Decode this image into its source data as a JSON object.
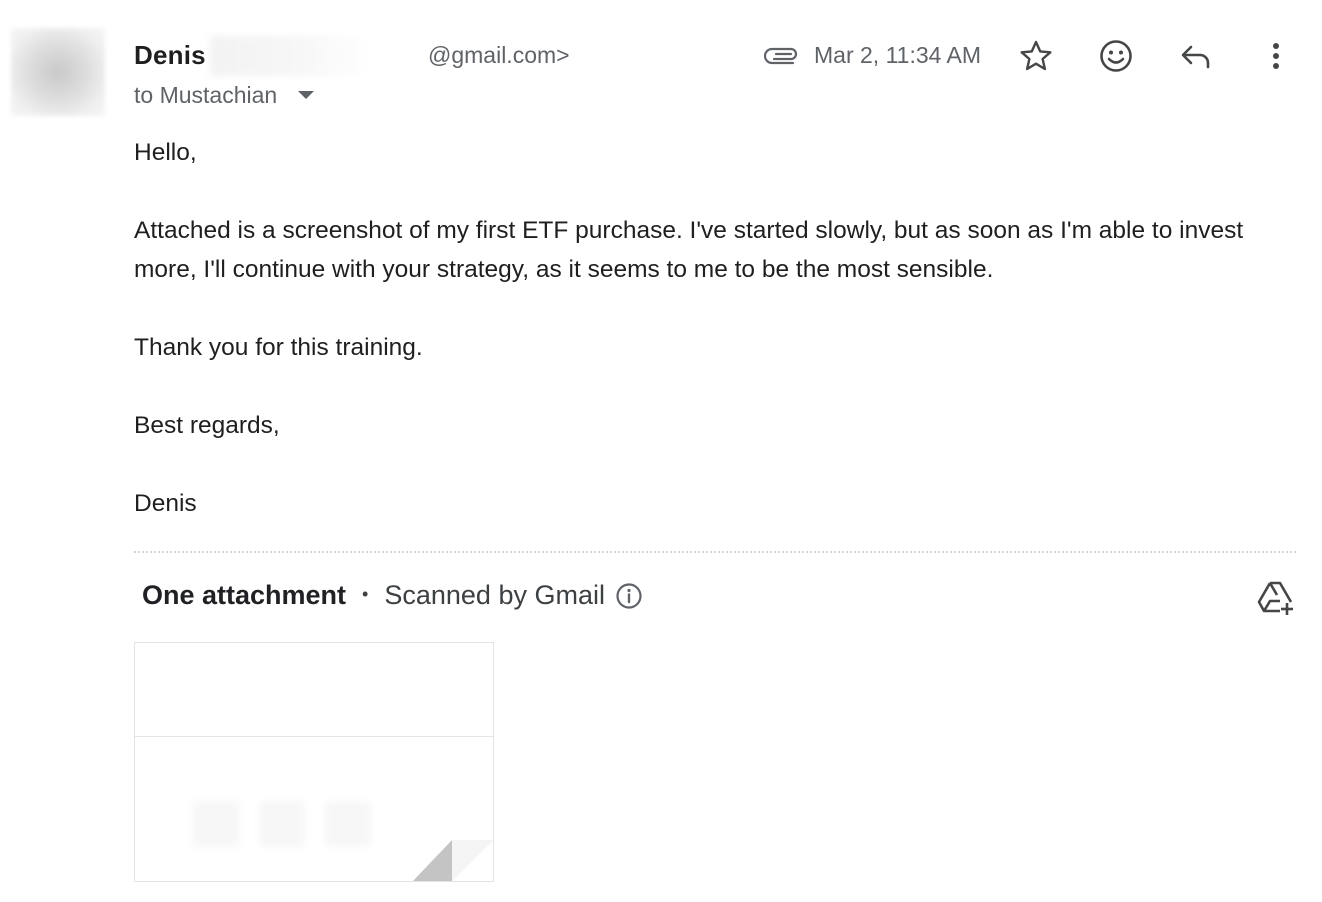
{
  "header": {
    "sender_name": "Denis",
    "sender_email": "@gmail.com>",
    "recipient": "to Mustachian",
    "timestamp": "Mar 2, 11:34 AM",
    "icons": [
      "attachment-clip-icon",
      "star-icon",
      "emoji-icon",
      "reply-icon",
      "more-vert-icon"
    ]
  },
  "message": {
    "paragraphs": [
      "Hello,",
      "Attached is a screenshot of my first ETF purchase. I've started slowly, but as soon as I'm able to invest more, I'll continue with your strategy, as it seems to me to be the most sensible.",
      "Thank you for this training.",
      "Best regards,",
      "Denis"
    ]
  },
  "attachments": {
    "title": "One attachment",
    "separator": "•",
    "scanned_label": "Scanned by Gmail",
    "icons": [
      "info-icon",
      "add-to-drive-icon"
    ]
  },
  "colors": {
    "text_primary": "#1f1f1f",
    "text_secondary": "#5f6368",
    "divider": "#d5d5d5"
  }
}
